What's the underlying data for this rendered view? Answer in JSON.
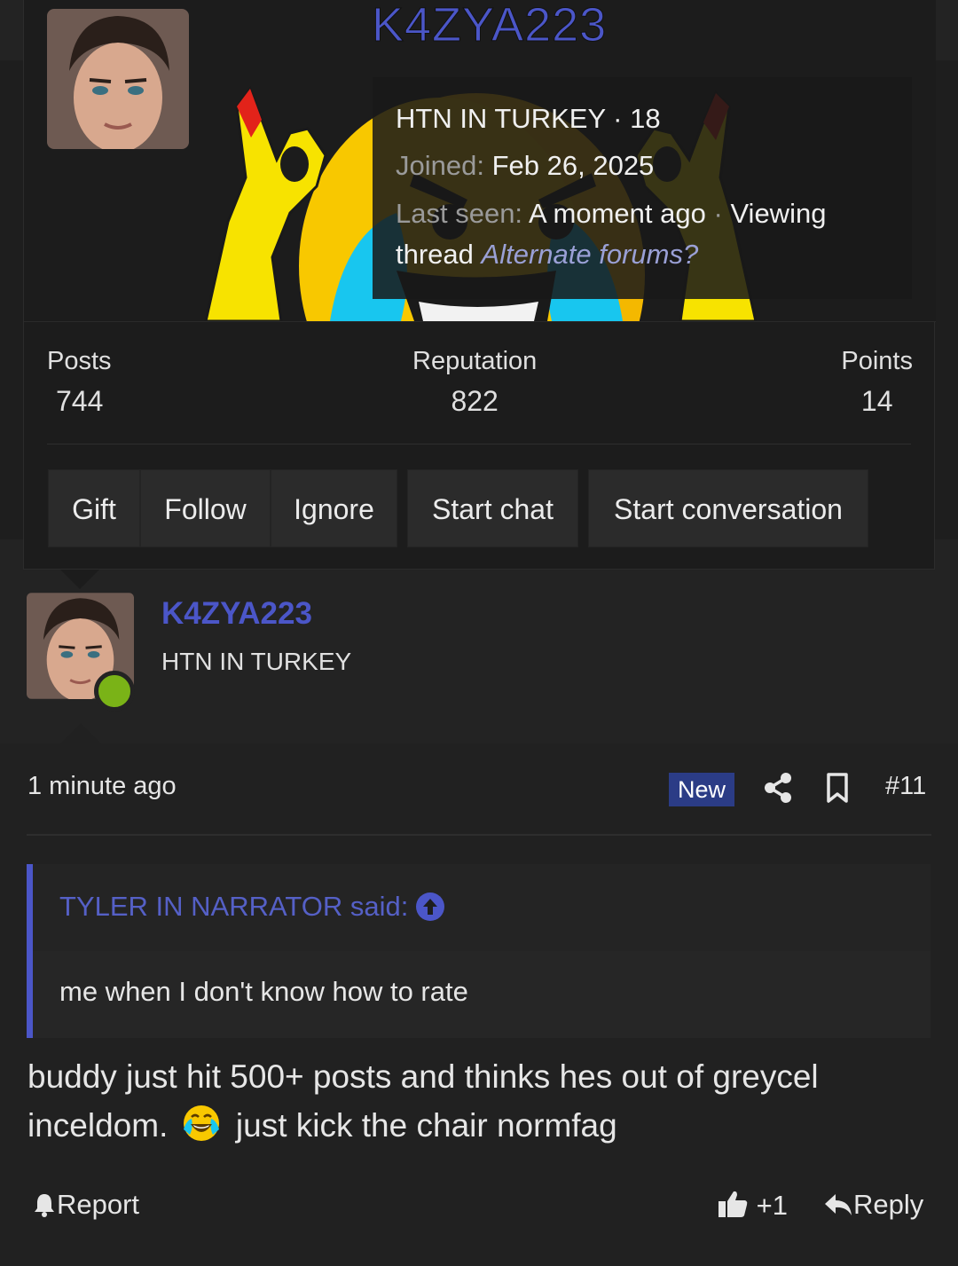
{
  "popup": {
    "username": "K4ZYA223",
    "info": {
      "title_line": "HTN IN TURKEY · 18",
      "joined_label": "Joined:",
      "joined_value": "Feb 26, 2025",
      "last_seen_label": "Last seen:",
      "last_seen_value": "A moment ago",
      "sep": "·",
      "viewing": "Viewing",
      "thread_label": "thread",
      "thread_name": "Alternate forums?"
    },
    "stats": [
      {
        "label": "Posts",
        "value": "744"
      },
      {
        "label": "Reputation",
        "value": "822"
      },
      {
        "label": "Points",
        "value": "14"
      }
    ],
    "buttons": {
      "gift": "Gift",
      "follow": "Follow",
      "ignore": "Ignore",
      "start_chat": "Start chat",
      "start_conversation": "Start conversation"
    }
  },
  "post": {
    "author": "K4ZYA223",
    "author_title": "HTN IN TURKEY",
    "online": true,
    "timestamp": "1 minute ago",
    "badge": "New",
    "post_number": "#11",
    "quote": {
      "author_said": "TYLER IN NARRATOR said:",
      "text": "me when I don't know how to rate"
    },
    "body_part1": "buddy just hit 500+ posts and thinks hes out of greycel inceldom.",
    "body_emoji": "face-with-tears-of-joy",
    "body_part2": "just kick the chair normfag",
    "actions": {
      "report": "Report",
      "like_count": "+1",
      "reply": "Reply"
    }
  },
  "colors": {
    "accent": "#4b56c8",
    "online": "#7ab317",
    "badge": "#2b3c86",
    "background": "#232323"
  },
  "icons": [
    "share-icon",
    "bookmark-icon",
    "arrow-up-icon",
    "bell-icon",
    "thumbs-up-icon",
    "reply-icon"
  ]
}
